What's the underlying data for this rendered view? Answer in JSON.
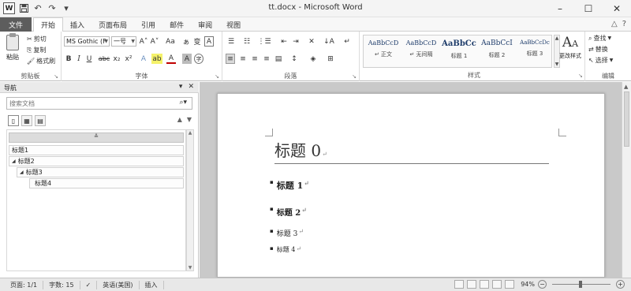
{
  "window": {
    "title": "tt.docx - Microsoft Word",
    "app_icon_letter": "W",
    "qat": {
      "save_icon": "save-icon",
      "undo_icon": "undo-icon",
      "redo_icon": "redo-icon"
    },
    "controls": {
      "minimize": "–",
      "restore": "☐",
      "close": "✕"
    }
  },
  "tabs": {
    "file": "文件",
    "items": [
      {
        "label": "开始",
        "active": true
      },
      {
        "label": "插入",
        "active": false
      },
      {
        "label": "页面布局",
        "active": false
      },
      {
        "label": "引用",
        "active": false
      },
      {
        "label": "邮件",
        "active": false
      },
      {
        "label": "审阅",
        "active": false
      },
      {
        "label": "视图",
        "active": false
      }
    ],
    "right": {
      "minimize_ribbon": "△",
      "help": "?"
    }
  },
  "ribbon": {
    "clipboard": {
      "label": "剪贴板",
      "paste": "粘贴",
      "cut": "剪切",
      "copy": "复制",
      "format_painter": "格式刷"
    },
    "font": {
      "label": "字体",
      "font_name": "MS Gothic (F",
      "font_size": "一号",
      "grow": "A˄",
      "shrink": "A˅",
      "change_case": "Aa",
      "clear_format": "ぁ",
      "phonetic": "变",
      "border_char": "A",
      "bold": "B",
      "italic": "I",
      "underline": "U",
      "strike": "abc",
      "subscript": "x₂",
      "superscript": "x²",
      "text_effect": "A",
      "highlight": "ab",
      "font_color": "A",
      "shading": "A",
      "enclose": "字"
    },
    "paragraph": {
      "label": "段落",
      "bullets": "☰",
      "numbering": "☷",
      "multilevel": "⋮☰",
      "decrease_indent": "⇤",
      "increase_indent": "⇥",
      "chinese_layout": "✕",
      "sort": "↓A",
      "show_marks": "↵",
      "align_left": "≡",
      "center": "≡",
      "align_right": "≡",
      "justify": "≡",
      "distribute": "▤",
      "line_spacing": "↕",
      "shading": "◈",
      "borders": "⊞"
    },
    "styles": {
      "label": "样式",
      "items": [
        {
          "sample": "AaBbCcD",
          "name": "↵ 正文"
        },
        {
          "sample": "AaBbCcD",
          "name": "↵ 无间隔"
        },
        {
          "sample": "AaBbCc",
          "name": "标题 1"
        },
        {
          "sample": "AaBbCcI",
          "name": "标题 2"
        },
        {
          "sample": "AaBbCcDc",
          "name": "标题 3"
        }
      ],
      "change_styles": "更改样式"
    },
    "editing": {
      "label": "编辑",
      "find": "查找",
      "replace": "替换",
      "select": "选择"
    }
  },
  "nav": {
    "title": "导航",
    "search_placeholder": "搜索文档",
    "collapse_symbol": "≚",
    "up_arrow": "▲",
    "down_arrow": "▼",
    "items": [
      {
        "label": "标题1",
        "level": 1,
        "expander": ""
      },
      {
        "label": "标题2",
        "level": 1,
        "expander": "◢"
      },
      {
        "label": "标题3",
        "level": 2,
        "expander": "◢"
      },
      {
        "label": "标题4",
        "level": 3,
        "expander": ""
      }
    ]
  },
  "document": {
    "heading0": "标题 0",
    "paragraph_mark": "↵",
    "items": [
      {
        "text": "标题 1",
        "size": 11,
        "bold": true
      },
      {
        "text": "标题 2",
        "size": 10,
        "bold": true
      },
      {
        "text": "标题 3",
        "size": 9,
        "bold": false
      },
      {
        "text": "标题 4",
        "size": 8,
        "bold": false
      }
    ]
  },
  "status": {
    "page": "页面: 1/1",
    "words": "字数: 15",
    "language": "英语(美国)",
    "mode": "插入",
    "zoom": "94%",
    "zoom_out": "−",
    "zoom_in": "+"
  }
}
